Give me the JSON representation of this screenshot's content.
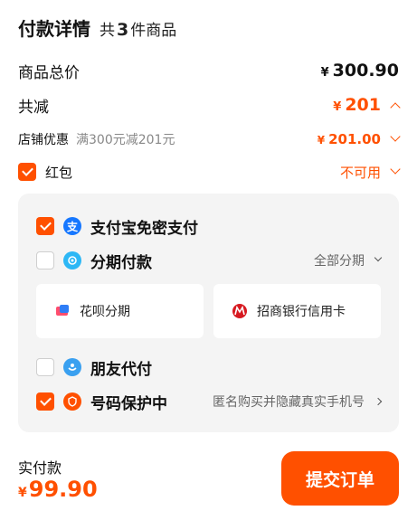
{
  "header": {
    "title": "付款详情",
    "count_prefix": "共",
    "count": "3",
    "count_suffix": "件商品"
  },
  "summary": {
    "total_label": "商品总价",
    "total_currency": "¥",
    "total_value": "300.90",
    "discount_label": "共减",
    "discount_currency": "¥",
    "discount_value": "201"
  },
  "store_discount": {
    "label": "店铺优惠",
    "description": "满300元减201元",
    "currency": "¥",
    "value": "201.00"
  },
  "red_packet": {
    "label": "红包",
    "status": "不可用",
    "checked": true
  },
  "payment": {
    "alipay": {
      "label": "支付宝免密支付",
      "icon": "alipay-icon",
      "checked": true
    },
    "installment": {
      "label": "分期付款",
      "icon": "installment-icon",
      "checked": false,
      "right_label": "全部分期",
      "options": [
        {
          "label": "花呗分期",
          "icon": "huabei-icon"
        },
        {
          "label": "招商银行信用卡",
          "icon": "cmb-bank-icon"
        }
      ]
    },
    "friend_pay": {
      "label": "朋友代付",
      "icon": "friend-pay-icon",
      "checked": false
    },
    "number_protect": {
      "label": "号码保护中",
      "icon": "shield-icon",
      "checked": true,
      "right_label": "匿名购买并隐藏真实手机号"
    }
  },
  "footer": {
    "pay_label": "实付款",
    "currency": "¥",
    "pay_value": "99.90",
    "submit_label": "提交订单"
  },
  "colors": {
    "accent": "#ff5000",
    "alipay": "#1677ff",
    "installment": "#2db7f5",
    "friend": "#3aa0f0",
    "protect": "#ff5000"
  }
}
